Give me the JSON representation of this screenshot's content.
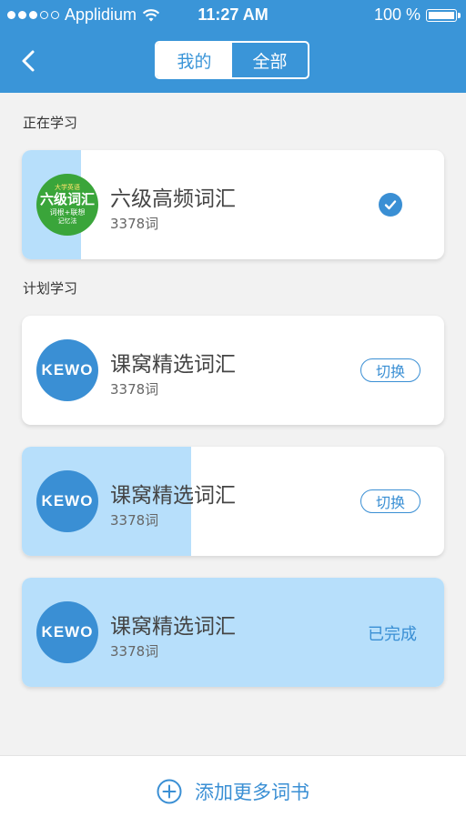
{
  "status_bar": {
    "carrier": "Applidium",
    "time": "11:27 AM",
    "battery": "100 %"
  },
  "nav": {
    "tabs": [
      {
        "label": "我的",
        "active": true
      },
      {
        "label": "全部",
        "active": false
      }
    ]
  },
  "sections": {
    "current": "正在学习",
    "planned": "计划学习"
  },
  "current_book": {
    "title": "六级高频词汇",
    "count": "3378词",
    "progress": 0.14,
    "cover": {
      "line1": "大学英语",
      "line2": "六级词汇",
      "line3": "词根+联想",
      "line4": "记忆法"
    }
  },
  "planned_books": [
    {
      "title": "课窝精选词汇",
      "count": "3378词",
      "logo": "KEWO",
      "action": "切换",
      "progress": 0.0
    },
    {
      "title": "课窝精选词汇",
      "count": "3378词",
      "logo": "KEWO",
      "action": "切换",
      "progress": 0.4
    },
    {
      "title": "课窝精选词汇",
      "count": "3378词",
      "logo": "KEWO",
      "action": "已完成",
      "progress": 1.0
    }
  ],
  "footer": {
    "add_label": "添加更多词书"
  },
  "colors": {
    "primary": "#3a95d8",
    "accent": "#3a8fd4",
    "progress": "#b7dffb"
  }
}
